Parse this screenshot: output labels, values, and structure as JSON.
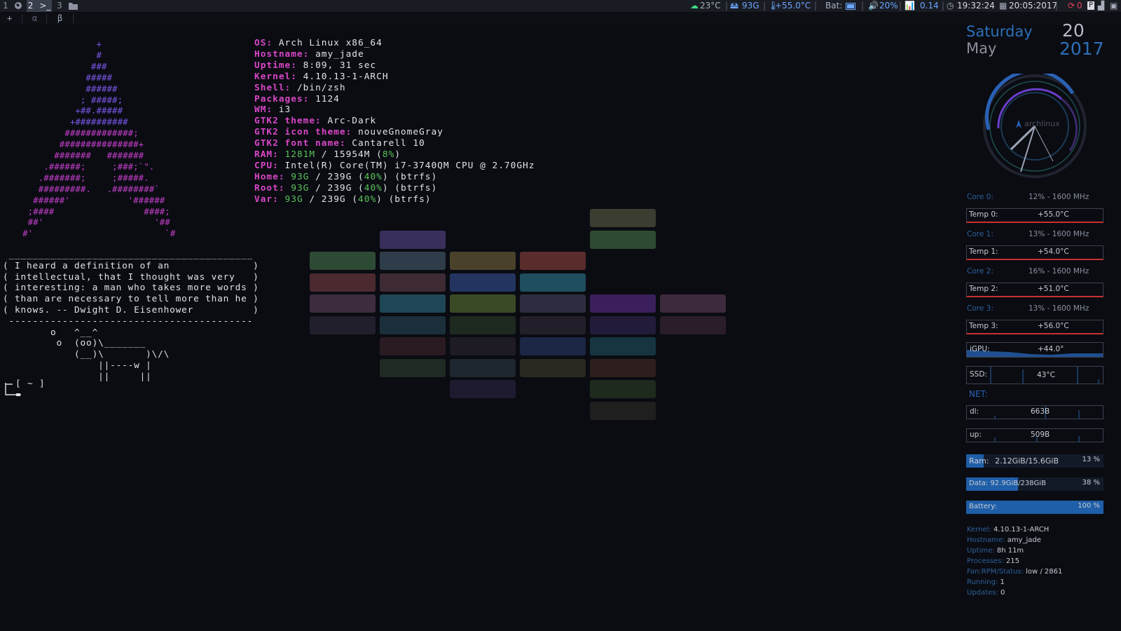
{
  "topbar": {
    "workspaces": [
      {
        "num": "1",
        "icon": "globe-icon"
      },
      {
        "num": "2",
        "icon": "terminal-icon",
        "icon_text": ">_"
      },
      {
        "num": "3",
        "icon": "folder-icon"
      }
    ],
    "weather": "23°C",
    "disk": "93G",
    "cpu_temp": "+55.0°C",
    "battery_label": "Bat:",
    "volume": "20%",
    "load": "0.14",
    "time": "19:32:24",
    "date": "20:05:2017",
    "updates": "0"
  },
  "tabbar": {
    "tabs": [
      "+",
      "α",
      "β"
    ]
  },
  "neofetch": {
    "ascii_color": "#7a56e8",
    "ascii_color2": "#c23ec8",
    "info": [
      {
        "key": "OS:",
        "value": "Arch Linux x86_64"
      },
      {
        "key": "Hostname:",
        "value": "amy_jade"
      },
      {
        "key": "Uptime:",
        "value": "8:09, 31 sec"
      },
      {
        "key": "Kernel:",
        "value": "4.10.13-1-ARCH"
      },
      {
        "key": "Shell:",
        "value": "/bin/zsh"
      },
      {
        "key": "Packages:",
        "value": "1124"
      },
      {
        "key": "WM:",
        "value": "i3"
      },
      {
        "key": "GTK2 theme:",
        "value": "Arc-Dark"
      },
      {
        "key": "GTK2 icon theme:",
        "value": "nouveGnomeGray"
      },
      {
        "key": "GTK2 font name:",
        "value": "Cantarell 10"
      }
    ],
    "ram": {
      "key": "RAM:",
      "used": "1281M",
      "sep": " / ",
      "total": "15954M",
      "open": " (",
      "pct": "8%",
      "close": ")"
    },
    "cpu": {
      "key": "CPU:",
      "value": "Intel(R) Core(TM) i7-3740QM CPU @ 2.70GHz"
    },
    "disks": [
      {
        "key": "Home:",
        "used": "93G",
        "sep": " / ",
        "total": "239G",
        "open": " (",
        "pct": "40%",
        "close": ") (btrfs)"
      },
      {
        "key": "Root:",
        "used": "93G",
        "sep": " / ",
        "total": "239G",
        "open": " (",
        "pct": "40%",
        "close": ") (btrfs)"
      },
      {
        "key": "Var:",
        "used": "93G",
        "sep": " / ",
        "total": "239G",
        "open": " (",
        "pct": "40%",
        "close": ") (btrfs)"
      }
    ]
  },
  "cowsay": {
    "lines": [
      " _________________________________________",
      "( I heard a definition of an              )",
      "( intellectual, that I thought was very   )",
      "( interesting: a man who takes more words )",
      "( than are necessary to tell more than he )",
      "( knows. -- Dwight D. Eisenhower          )",
      " -----------------------------------------",
      "        o   ^__^",
      "         o  (oo)\\_______",
      "            (__)\\       )\\/\\",
      "                ||----w |",
      "                ||     ||"
    ],
    "prompt": "[ ~ ]"
  },
  "conky": {
    "day": "Saturday",
    "month": "May",
    "date": "20",
    "year": "2017",
    "clock_logo": "archlinux",
    "cores": [
      {
        "label": "Core 0:",
        "value": "12% - 1600 MHz",
        "temp_label": "Temp 0:",
        "temp": "+55.0°C"
      },
      {
        "label": "Core 1:",
        "value": "13% - 1600 MHz",
        "temp_label": "Temp 1:",
        "temp": "+54.0°C"
      },
      {
        "label": "Core 2:",
        "value": "16% - 1600 MHz",
        "temp_label": "Temp 2:",
        "temp": "+51.0°C"
      },
      {
        "label": "Core 3:",
        "value": "13% - 1600 MHz",
        "temp_label": "Temp 3:",
        "temp": "+56.0°C"
      }
    ],
    "igpu_label": "iGPU:",
    "igpu": "+44.0°",
    "ssd_label": "SSD:",
    "ssd": "43°C",
    "net_title": "NET:",
    "dl_label": "dl:",
    "dl": "663B",
    "up_label": "up:",
    "up": "509B",
    "ram_label": "Ram:",
    "ram": "2.12GiB/15.6GiB",
    "ram_pct": "13 %",
    "ram_frac": 0.13,
    "data_label": "Data:",
    "data": "92.9GiB/238GiB",
    "data_pct": "38 %",
    "data_frac": 0.38,
    "battery_label": "Battery:",
    "battery_pct": "100 %",
    "battery_frac": 1.0,
    "sys": [
      {
        "label": "Kernel:",
        "value": "4.10.13-1-ARCH"
      },
      {
        "label": "Hostname:",
        "value": "amy_jade"
      },
      {
        "label": "Uptime:",
        "value": "8h 11m"
      },
      {
        "label": "Processes:",
        "value": "215"
      },
      {
        "label": "Fan:RPM/Status:",
        "value": "low / 2861"
      },
      {
        "label": "Running:",
        "value": "1"
      },
      {
        "label": "Updates:",
        "value": "0"
      }
    ]
  }
}
